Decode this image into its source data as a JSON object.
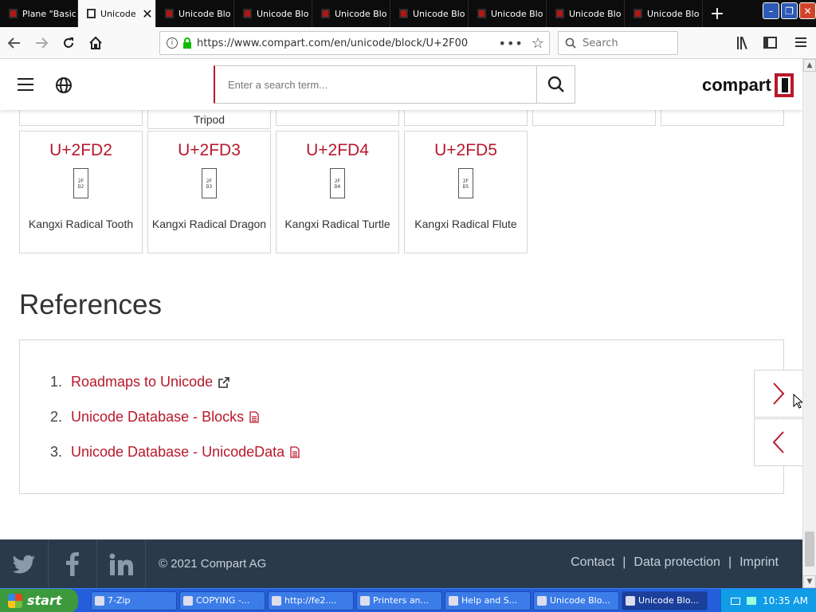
{
  "browser": {
    "tabs": [
      {
        "title": "Plane \"Basic"
      },
      {
        "title": "Unicode",
        "active": true
      },
      {
        "title": "Unicode Blo"
      },
      {
        "title": "Unicode Blo"
      },
      {
        "title": "Unicode Blo"
      },
      {
        "title": "Unicode Blo"
      },
      {
        "title": "Unicode Blo"
      },
      {
        "title": "Unicode Blo"
      },
      {
        "title": "Unicode Blo"
      }
    ],
    "url": "https://www.compart.com/en/unicode/block/U+2F00",
    "search_placeholder": "Search"
  },
  "site": {
    "search_placeholder": "Enter a search term...",
    "logo": "compart",
    "partial_card_text": "Tripod"
  },
  "cards": [
    {
      "code": "U+2FD2",
      "glyph": "2F D2",
      "name": "Kangxi Radical Tooth"
    },
    {
      "code": "U+2FD3",
      "glyph": "2F D3",
      "name": "Kangxi Radical Dragon"
    },
    {
      "code": "U+2FD4",
      "glyph": "2F D4",
      "name": "Kangxi Radical Turtle"
    },
    {
      "code": "U+2FD5",
      "glyph": "2F D5",
      "name": "Kangxi Radical Flute"
    }
  ],
  "references": {
    "heading": "References",
    "items": [
      {
        "num": "1.",
        "label": "Roadmaps to Unicode",
        "icon": "external-link-icon"
      },
      {
        "num": "2.",
        "label": "Unicode Database - Blocks",
        "icon": "document-icon"
      },
      {
        "num": "3.",
        "label": "Unicode Database - UnicodeData",
        "icon": "document-icon"
      }
    ]
  },
  "footer": {
    "copyright": "© 2021 Compart AG",
    "links": [
      "Contact",
      "Data protection",
      "Imprint"
    ],
    "separator": "|"
  },
  "taskbar": {
    "start": "start",
    "tasks": [
      {
        "label": "7-Zip"
      },
      {
        "label": "COPYING -..."
      },
      {
        "label": "http://fe2...."
      },
      {
        "label": "Printers an..."
      },
      {
        "label": "Help and S..."
      },
      {
        "label": "Unicode Blo..."
      },
      {
        "label": "Unicode Blo...",
        "active": true
      }
    ],
    "clock": "10:35 AM"
  },
  "colors": {
    "accent": "#b8182b",
    "footer_bg": "#2a3a4b",
    "taskbar": "#245edb"
  }
}
